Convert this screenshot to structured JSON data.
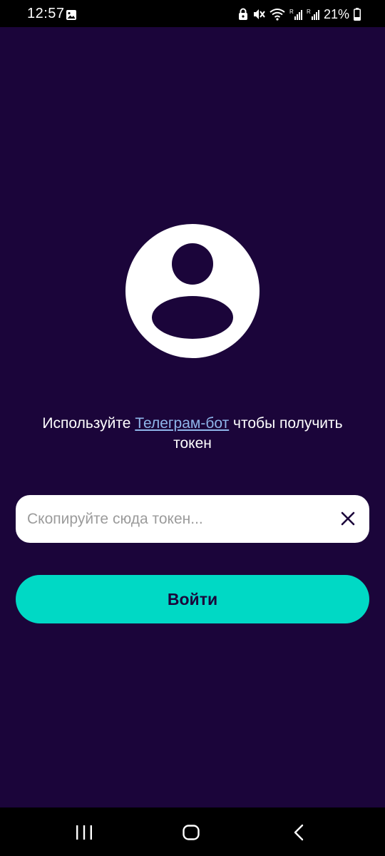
{
  "status_bar": {
    "time": "12:57",
    "battery_percent": "21%",
    "icons": [
      "gallery-icon",
      "lock-icon",
      "mute-icon",
      "wifi-icon",
      "signal-icon",
      "signal-icon",
      "battery-icon"
    ]
  },
  "login": {
    "avatar_icon": "user-avatar-icon",
    "hint_before": "Используйте ",
    "hint_link": "Телеграм-бот",
    "hint_after": " чтобы получить токен",
    "token_value": "",
    "token_placeholder": "Скопируйте сюда токен...",
    "login_label": "Войти"
  },
  "nav_bar": {
    "icons": [
      "recent-apps-icon",
      "home-icon",
      "back-icon"
    ]
  },
  "colors": {
    "background": "#1b053a",
    "accent": "#00d9c5",
    "link": "#8fb6ea"
  }
}
